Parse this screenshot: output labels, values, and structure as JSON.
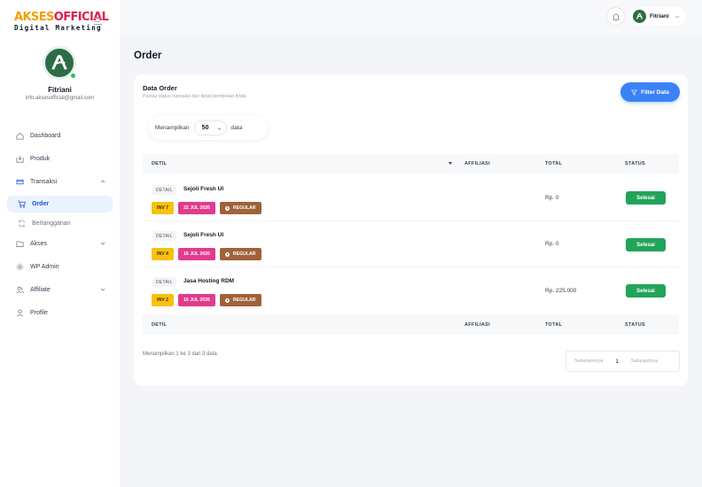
{
  "brand": {
    "name_part1": "AKSES",
    "name_part2": "OFFICIAL",
    "tagline": "Digital Marketing"
  },
  "user": {
    "name": "Fitriani",
    "email": "info.aksesofficial@gmail.com",
    "avatar_letter": "A"
  },
  "nav": {
    "dashboard": "Dashboard",
    "produk": "Produk",
    "transaksi": "Transaksi",
    "order": "Order",
    "berlangganan": "Berlangganan",
    "akses": "Akses",
    "wp_admin": "WP Admin",
    "affiliate": "Affiliate",
    "profile": "Profile"
  },
  "page": {
    "title": "Order"
  },
  "card": {
    "title": "Data Order",
    "subtitle": "Pantau status transaksi dan detail pembelian Anda",
    "filter_label": "Filter Data"
  },
  "length": {
    "prefix": "Menampilkan",
    "value": "50",
    "suffix": "data"
  },
  "table": {
    "headers": {
      "detail": "DETIL",
      "affiliasi": "AFFILIASI",
      "total": "TOTAL",
      "status": "STATUS"
    },
    "rows": [
      {
        "detail": "DETAIL",
        "product": "Sejoli Fresh UI",
        "inv": "INV 7",
        "date": "22 JUL 2026",
        "type": "REGULAR",
        "affiliasi": "",
        "total": "Rp. 0",
        "status": "Selesai"
      },
      {
        "detail": "DETAIL",
        "product": "Sejoli Fresh UI",
        "inv": "INV 4",
        "date": "16 JUL 2026",
        "type": "REGULAR",
        "affiliasi": "",
        "total": "Rp. 0",
        "status": "Selesai"
      },
      {
        "detail": "DETAIL",
        "product": "Jasa Hosting RDM",
        "inv": "INV 2",
        "date": "16 JUL 2026",
        "type": "REGULAR",
        "affiliasi": "",
        "total": "Rp. 225.000",
        "status": "Selesai"
      }
    ]
  },
  "footer": {
    "info": "Menampilkan 1 ke 3 dari 3 data",
    "prev": "Sebelumnya",
    "page": "1",
    "next": "Selanjutnya"
  },
  "colors": {
    "primary": "#3b82f6",
    "success": "#22a35a",
    "inv": "#f7c10d",
    "date": "#e23b8d",
    "regular": "#a0623a",
    "avatar": "#2e6b47"
  }
}
